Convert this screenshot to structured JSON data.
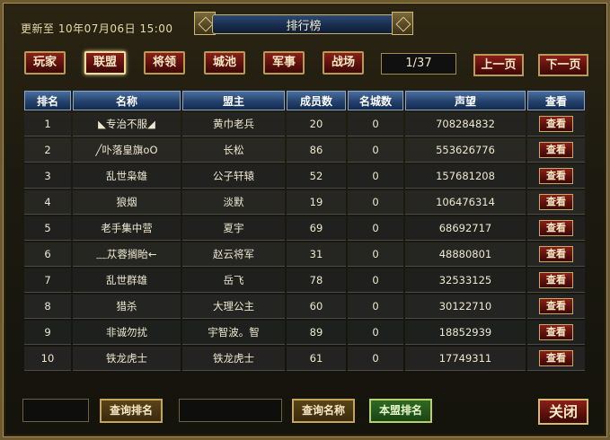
{
  "header": {
    "updated": "更新至 10年07月06日 15:00",
    "title": "排行榜"
  },
  "tabs": [
    "玩家",
    "联盟",
    "将领",
    "城池",
    "军事",
    "战场"
  ],
  "active_tab": "联盟",
  "pager": {
    "indicator": "1/37",
    "prev": "上一页",
    "next": "下一页"
  },
  "table": {
    "columns": [
      "排名",
      "名称",
      "盟主",
      "成员数",
      "名城数",
      "声望",
      "查看"
    ],
    "view_label": "查看",
    "rows": [
      {
        "rank": "1",
        "name": "◣专治不服◢",
        "leader": "黄巾老兵",
        "members": "20",
        "cities": "0",
        "prestige": "708284832"
      },
      {
        "rank": "2",
        "name": "╱卟落皇旗oO",
        "leader": "长松",
        "members": "86",
        "cities": "0",
        "prestige": "553626776"
      },
      {
        "rank": "3",
        "name": "乱世枭雄",
        "leader": "公子轩辕",
        "members": "52",
        "cities": "0",
        "prestige": "157681208"
      },
      {
        "rank": "4",
        "name": "狼烟",
        "leader": "淡默",
        "members": "19",
        "cities": "0",
        "prestige": "106476314"
      },
      {
        "rank": "5",
        "name": "老手集中营",
        "leader": "夏宇",
        "members": "69",
        "cities": "0",
        "prestige": "68692717"
      },
      {
        "rank": "6",
        "name": "﹏苁蓉搁眙←",
        "leader": "赵云将军",
        "members": "31",
        "cities": "0",
        "prestige": "48880801"
      },
      {
        "rank": "7",
        "name": "乱世群雄",
        "leader": "岳飞",
        "members": "78",
        "cities": "0",
        "prestige": "32533125"
      },
      {
        "rank": "8",
        "name": "猎杀",
        "leader": "大理公主",
        "members": "60",
        "cities": "0",
        "prestige": "30122710"
      },
      {
        "rank": "9",
        "name": "非诚勿扰",
        "leader": "宇智波。智",
        "members": "89",
        "cities": "0",
        "prestige": "18852939"
      },
      {
        "rank": "10",
        "name": "铁龙虎士",
        "leader": "铁龙虎士",
        "members": "61",
        "cities": "0",
        "prestige": "17749311"
      }
    ]
  },
  "footer": {
    "rank_input": "",
    "name_input": "",
    "search_rank": "查询排名",
    "search_name": "查询名称",
    "my_alliance_rank": "本盟排名",
    "close": "关闭"
  }
}
